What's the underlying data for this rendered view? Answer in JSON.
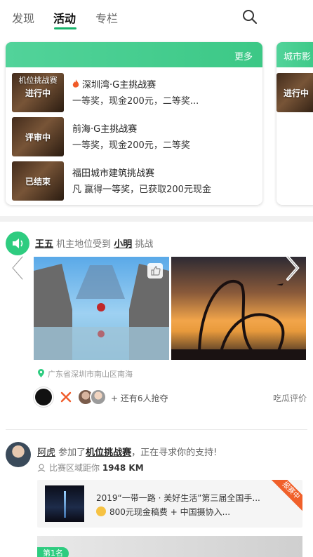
{
  "tabs": [
    {
      "label": "发现"
    },
    {
      "label": "活动"
    },
    {
      "label": "专栏"
    }
  ],
  "active_tab": "活动",
  "accent_color": "#2ecc80",
  "challenge_card": {
    "more_label": "更多",
    "items": [
      {
        "status": "进行中",
        "thumb_caption": "机位挑战赛",
        "title": "深圳湾·G主挑战赛",
        "hot": true,
        "subtitle": "一等奖，现金200元，二等奖..."
      },
      {
        "status": "评审中",
        "title": "前海·G主挑战赛",
        "subtitle": "一等奖，现金200元，二等奖"
      },
      {
        "status": "已结束",
        "title": "福田城市建筑挑战赛",
        "subtitle": "凡 赢得一等奖，已获取200元现金"
      }
    ]
  },
  "side_card": {
    "title": "城市影",
    "thumb_caption": "进行中"
  },
  "post1": {
    "user": "王五",
    "text_before": " 机主地位受到 ",
    "target": "小明",
    "text_after": " 挑战",
    "location": "广东省深圳市南山区南海",
    "grab_text": "+ 还有6人抢夺",
    "comment_label": "吃瓜评价"
  },
  "post2": {
    "user": "阿虎",
    "text_before": " 参加了",
    "event": "机位挑战赛",
    "text_after": "，正在寻求你的支持!",
    "distance_label": "比赛区域距你 ",
    "distance_value": "1948 KM",
    "share": {
      "title": "2019“一带一路 · 美好生活”第三届全国手...",
      "subtitle": "800元现金稿费 + 中国摄协入...",
      "ribbon": "报赛中"
    },
    "rank_badge": "第1名"
  }
}
